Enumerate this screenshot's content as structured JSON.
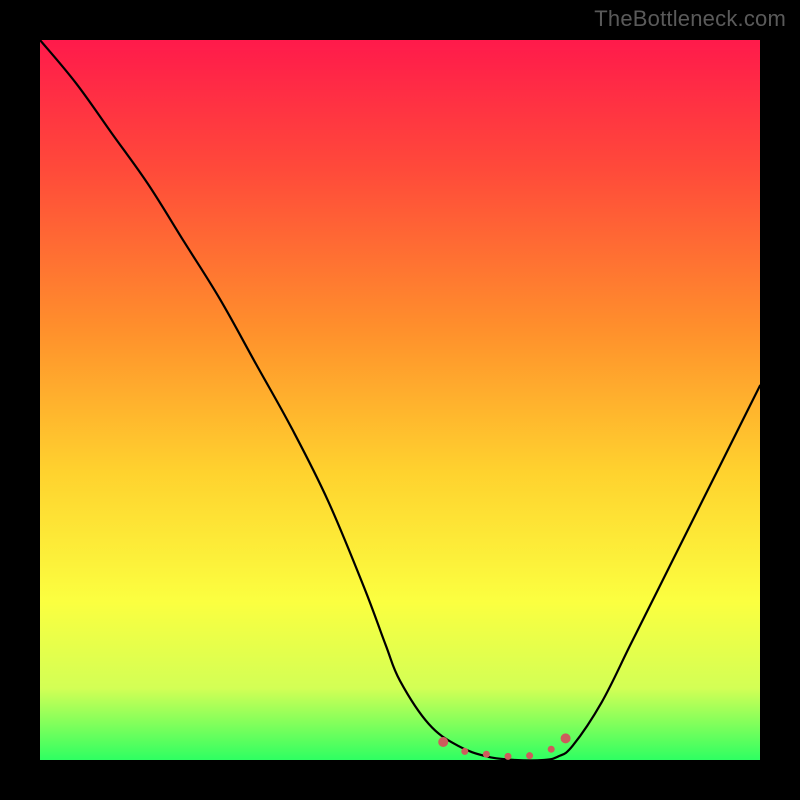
{
  "watermark": "TheBottleneck.com",
  "chart_data": {
    "type": "line",
    "title": "",
    "xlabel": "",
    "ylabel": "",
    "xlim": [
      0,
      100
    ],
    "ylim": [
      0,
      100
    ],
    "grid": false,
    "legend": false,
    "gradient_stops": [
      {
        "offset": 0.0,
        "color": "#ff1a4b"
      },
      {
        "offset": 0.18,
        "color": "#ff4a3a"
      },
      {
        "offset": 0.4,
        "color": "#ff8f2c"
      },
      {
        "offset": 0.6,
        "color": "#ffd22e"
      },
      {
        "offset": 0.78,
        "color": "#fbff40"
      },
      {
        "offset": 0.9,
        "color": "#d3ff55"
      },
      {
        "offset": 1.0,
        "color": "#2eff62"
      }
    ],
    "series": [
      {
        "name": "curve",
        "x": [
          0,
          5,
          10,
          15,
          20,
          25,
          30,
          35,
          40,
          45,
          48,
          50,
          54,
          58,
          62,
          66,
          70,
          72,
          74,
          78,
          82,
          86,
          90,
          94,
          98,
          100
        ],
        "values": [
          100,
          94,
          87,
          80,
          72,
          64,
          55,
          46,
          36,
          24,
          16,
          11,
          5,
          2,
          0.5,
          0,
          0,
          0.5,
          2,
          8,
          16,
          24,
          32,
          40,
          48,
          52
        ]
      }
    ],
    "markers": {
      "name": "highlight-dots",
      "color": "#cd5c5c",
      "points": [
        {
          "x": 56,
          "y": 2.5,
          "r": 5
        },
        {
          "x": 59,
          "y": 1.2,
          "r": 3.5
        },
        {
          "x": 62,
          "y": 0.8,
          "r": 3.5
        },
        {
          "x": 65,
          "y": 0.5,
          "r": 3.5
        },
        {
          "x": 68,
          "y": 0.6,
          "r": 3.5
        },
        {
          "x": 71,
          "y": 1.5,
          "r": 3.5
        },
        {
          "x": 73,
          "y": 3.0,
          "r": 5
        }
      ]
    }
  }
}
